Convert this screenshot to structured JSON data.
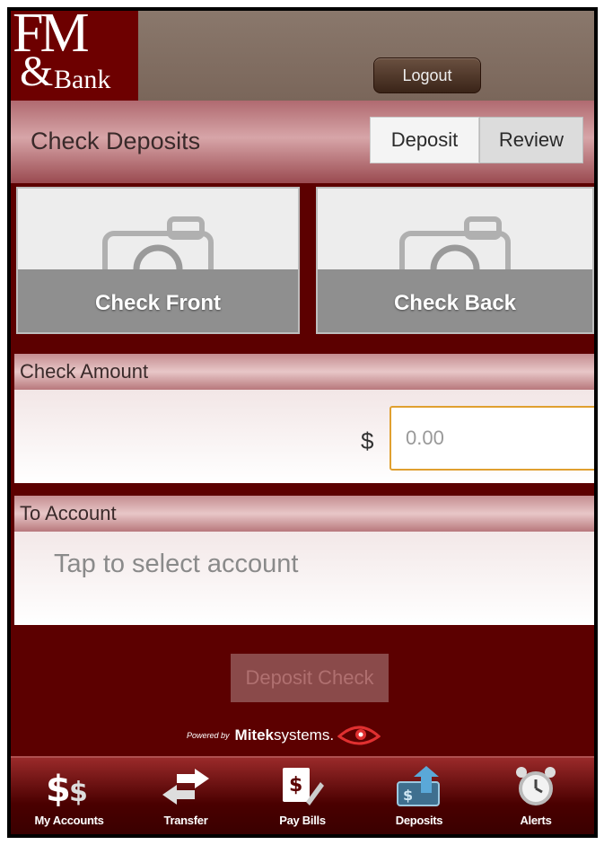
{
  "header": {
    "logo_fm": "FM",
    "logo_amp": "&",
    "logo_bank": "Bank",
    "logout_label": "Logout"
  },
  "title_bar": {
    "title": "Check Deposits",
    "tabs": [
      {
        "label": "Deposit",
        "selected": true
      },
      {
        "label": "Review",
        "selected": false
      }
    ]
  },
  "capture": {
    "front_label": "Check Front",
    "back_label": "Check Back",
    "icon": "camera-icon"
  },
  "amount": {
    "header": "Check Amount",
    "currency_symbol": "$",
    "placeholder": "0.00"
  },
  "account": {
    "header": "To Account",
    "prompt": "Tap to select account"
  },
  "deposit_button": "Deposit Check",
  "powered_by": {
    "prefix": "Powered by",
    "brand_bold": "Mitek",
    "brand_light": "systems."
  },
  "tab_bar": {
    "items": [
      {
        "label": "My Accounts",
        "icon": "dollar-signs-icon"
      },
      {
        "label": "Transfer",
        "icon": "transfer-arrows-icon"
      },
      {
        "label": "Pay Bills",
        "icon": "pay-bills-icon"
      },
      {
        "label": "Deposits",
        "icon": "deposit-icon",
        "active": true
      },
      {
        "label": "Alerts",
        "icon": "alarm-clock-icon"
      }
    ]
  },
  "colors": {
    "brand_maroon": "#5c0000",
    "input_focus": "#e0a030"
  }
}
